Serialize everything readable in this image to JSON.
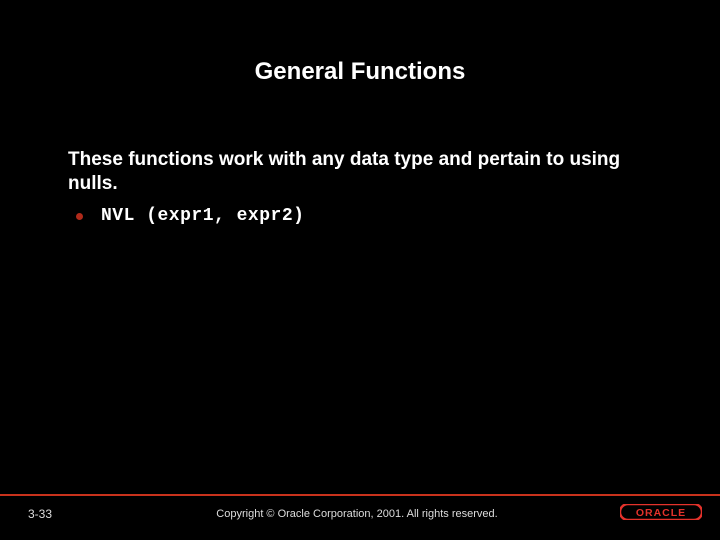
{
  "title": "General Functions",
  "lead": "These functions work with any data type and pertain to using nulls.",
  "bullets": [
    {
      "text": "NVL (expr1, expr2)"
    }
  ],
  "footer": {
    "page": "3-33",
    "copyright": "Copyright © Oracle Corporation, 2001. All rights reserved."
  },
  "colors": {
    "accent": "#c8321c",
    "bullet": "#b02a1a"
  }
}
